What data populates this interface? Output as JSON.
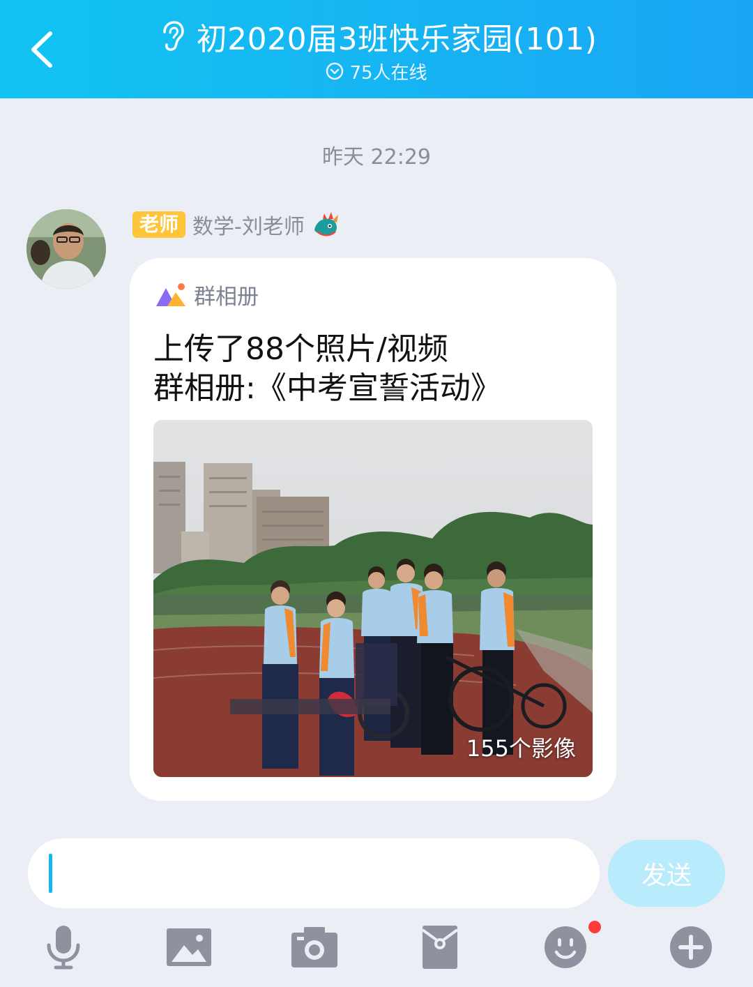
{
  "header": {
    "title": "初2020届3班快乐家园(101)",
    "online_status": "75人在线",
    "back_icon": "chevron-left-icon",
    "mode_icon": "ear-icon"
  },
  "chat": {
    "timestamp": "昨天 22:29",
    "message": {
      "sender_badge": "老师",
      "sender_name": "数学-刘老师",
      "card_type_label": "群相册",
      "line1": "上传了88个照片/视频",
      "line2": "群相册:《中考宣誓活动》",
      "photo_count": "155个影像"
    }
  },
  "input": {
    "value": "",
    "send_label": "发送"
  },
  "toolbar": {
    "items": [
      "microphone-icon",
      "image-icon",
      "camera-icon",
      "red-packet-icon",
      "emoji-icon",
      "plus-icon"
    ]
  },
  "colors": {
    "header_start": "#12c4f2",
    "header_end": "#1aa6f4",
    "badge": "#ffc53a",
    "send_disabled": "#b8ebfb",
    "icon_gray": "#8e919e",
    "notification_dot": "#ff3b3b"
  }
}
